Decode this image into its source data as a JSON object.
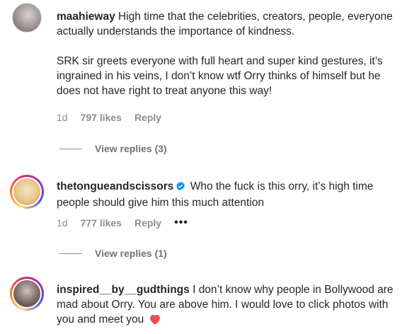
{
  "comments": [
    {
      "username": "maahieway",
      "paragraphs": [
        "High time that the celebrities, creators, people, everyone actually understands the importance of kindness.",
        "SRK sir greets everyone with full heart and super kind gestures, it’s ingrained in his veins, I don’t know wtf Orry thinks of himself but he does not have right to treat anyone this way!"
      ],
      "time": "1d",
      "likes": "797 likes",
      "reply": "Reply",
      "view_replies": "View replies (3)"
    },
    {
      "username": "thetongueandscissors",
      "text": "Who the fuck is this orry, it’s high time people should give him this much attention",
      "time": "1d",
      "likes": "777 likes",
      "reply": "Reply",
      "more": "•••",
      "view_replies": "View replies (1)"
    },
    {
      "username": "inspired__by__gudthings",
      "text": "I don’t know why people in Bollywood are mad about Orry. You are above him. I would love to click photos with you and meet you"
    }
  ],
  "colors": {
    "text": "#262626",
    "secondary": "#8e8e8e",
    "verified": "#0095f6",
    "heart": "#ed4956"
  }
}
